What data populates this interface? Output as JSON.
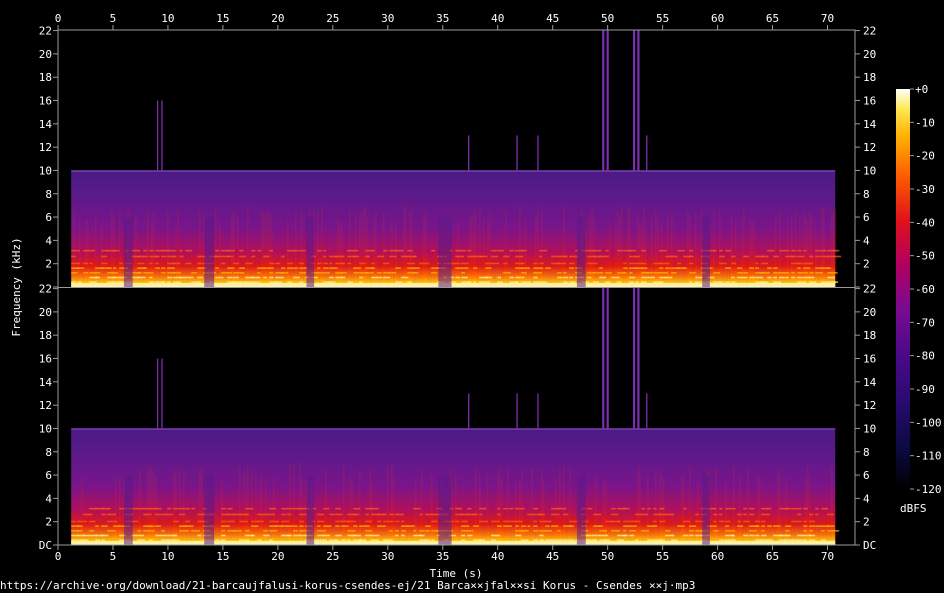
{
  "chart_data": {
    "type": "heatmap",
    "xlabel": "Time (s)",
    "ylabel": "Frequency (kHz)",
    "x_ticks": [
      0,
      5,
      10,
      15,
      20,
      25,
      30,
      35,
      40,
      45,
      50,
      55,
      60,
      65,
      70
    ],
    "xlim": [
      0,
      72.5
    ],
    "y_ticks": [
      "DC",
      "2",
      "4",
      "6",
      "8",
      "10",
      "12",
      "14",
      "16",
      "18",
      "20",
      "22"
    ],
    "ylim_khz": [
      0,
      22.05
    ],
    "channels": 2,
    "active_audio_range_s": [
      1.2,
      70.7
    ],
    "lowpass_cutoff_khz": 10,
    "transients_s": [
      9.0,
      9.4,
      37.3,
      41.7,
      43.6,
      49.5,
      49.9,
      52.3,
      52.7,
      53.5
    ],
    "colorbar": {
      "label": "dBFS",
      "ticks": [
        "+0",
        "-10",
        "-20",
        "-30",
        "-40",
        "-50",
        "-60",
        "-70",
        "-80",
        "-90",
        "-100",
        "-110",
        "-120"
      ],
      "range_db": [
        -120,
        0
      ]
    }
  },
  "footer_text": "https://archive·org/download/21-barcaujfalusi-korus-csendes-ej/21 Barca××jfal××si Korus - Csendes ××j·mp3"
}
